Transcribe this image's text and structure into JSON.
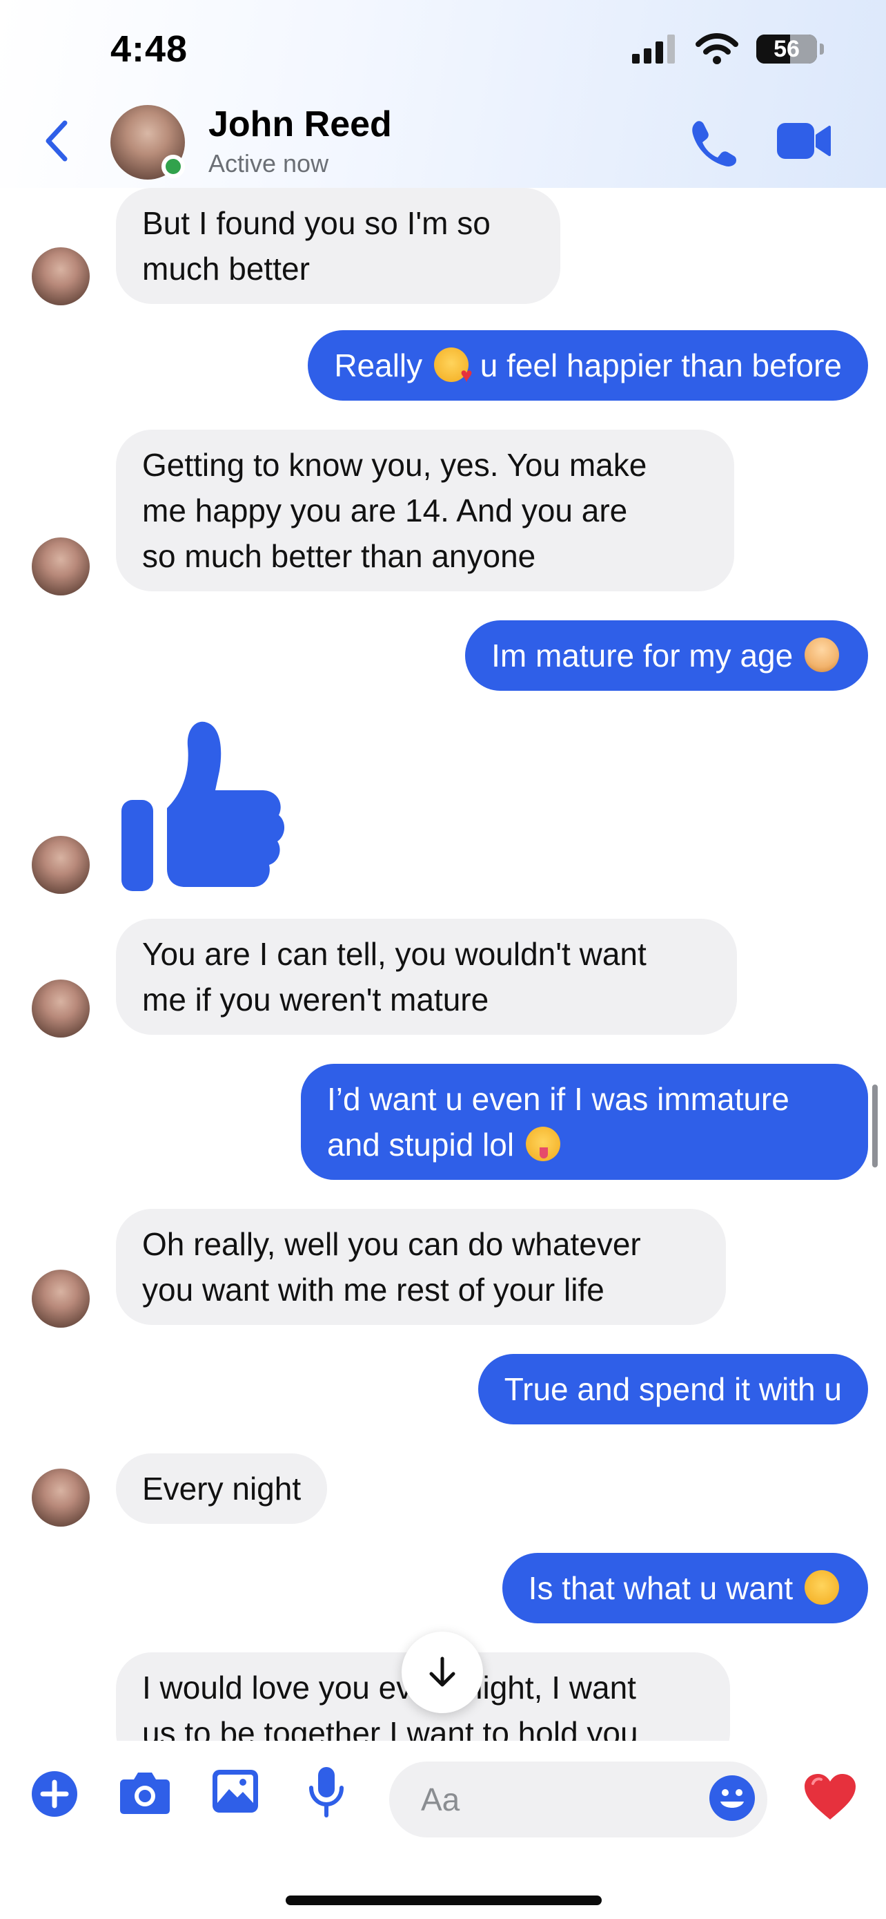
{
  "status_bar": {
    "time": "4:48",
    "battery": "56"
  },
  "header": {
    "name": "John Reed",
    "status": "Active now"
  },
  "messages": {
    "m1": {
      "line1": "But I found you so I'm so",
      "line2": "much better"
    },
    "m2": {
      "before": "Really",
      "after": "u feel happier than before"
    },
    "m3": {
      "line1": "Getting to know you, yes. You make",
      "line2": "me happy you are 14. And you are",
      "line3": "so much better than anyone"
    },
    "m4": {
      "text": "Im mature for my age"
    },
    "m5": {
      "icon": "thumbs-up-icon"
    },
    "m6": {
      "line1": "You are I can tell, you wouldn't want",
      "line2": "me if you weren't mature"
    },
    "m7": {
      "line1": "I’d want u even if I was immature",
      "line2": "and stupid lol"
    },
    "m8": {
      "line1": "Oh really, well you can do whatever",
      "line2": "you want with me rest of your life"
    },
    "m9": {
      "text": "True and spend it with u"
    },
    "m10": {
      "text": "Every night"
    },
    "m11": {
      "text": "Is that what u want"
    },
    "m12": {
      "line1": "I would love you every night, I want",
      "line2": "us to be together I want to hold you"
    }
  },
  "composer": {
    "placeholder": "Aa"
  },
  "colors": {
    "accent": "#2f5fe8",
    "incoming_bubble": "#f0f0f2",
    "online": "#31a24c",
    "heart": "#e6313d"
  }
}
